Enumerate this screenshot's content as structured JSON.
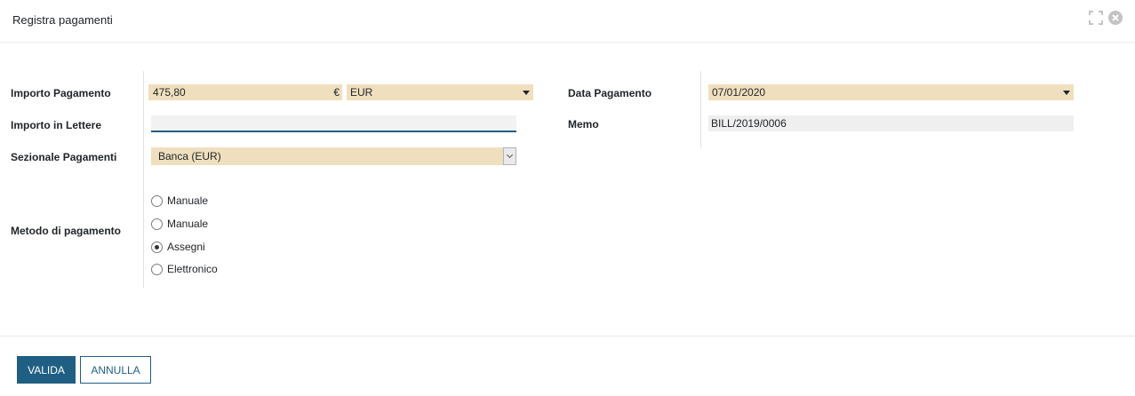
{
  "modal": {
    "title": "Registra pagamenti"
  },
  "form": {
    "amount_label": "Importo Pagamento",
    "amount_value": "475,80",
    "currency_symbol": "€",
    "currency_value": "EUR",
    "words_label": "Importo in Lettere",
    "words_value": "",
    "journal_label": "Sezionale Pagamenti",
    "journal_value": "Banca (EUR)",
    "method_label": "Metodo di pagamento",
    "methods": [
      {
        "label": "Manuale",
        "checked": false
      },
      {
        "label": "Manuale",
        "checked": false
      },
      {
        "label": "Assegni",
        "checked": true
      },
      {
        "label": "Elettronico",
        "checked": false
      }
    ],
    "date_label": "Data Pagamento",
    "date_value": "07/01/2020",
    "memo_label": "Memo",
    "memo_value": "BILL/2019/0006"
  },
  "footer": {
    "validate_label": "VALIDA",
    "cancel_label": "ANNULLA"
  },
  "colors": {
    "accent": "#1f5f84",
    "required_field": "#f0dfbe"
  },
  "icons": [
    "expand-icon",
    "close-icon"
  ]
}
